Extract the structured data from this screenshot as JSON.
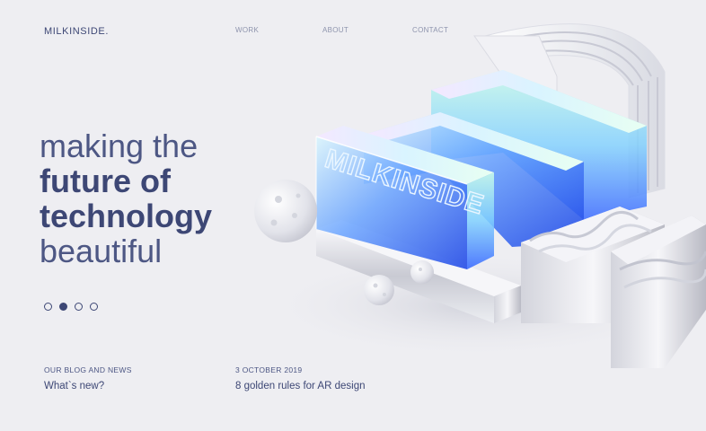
{
  "header": {
    "logo": "MILKINSIDE.",
    "nav": [
      "WORK",
      "ABOUT",
      "CONTACT"
    ]
  },
  "hero": {
    "line1": "making the",
    "line2": "future of",
    "line3": "technology",
    "line4": "beautiful"
  },
  "slider": {
    "dot_count": 4,
    "active_index": 1
  },
  "blog": {
    "label": "OUR BLOG AND NEWS",
    "title": "What`s new?"
  },
  "post": {
    "date": "3 OCTOBER 2019",
    "title": "8 golden rules for AR design"
  },
  "artwork": {
    "embossed_text": "MILKINSIDE",
    "accent_blue": "#2f6bff",
    "accent_cyan": "#8fe6ff",
    "text_color": "#3d4775"
  }
}
